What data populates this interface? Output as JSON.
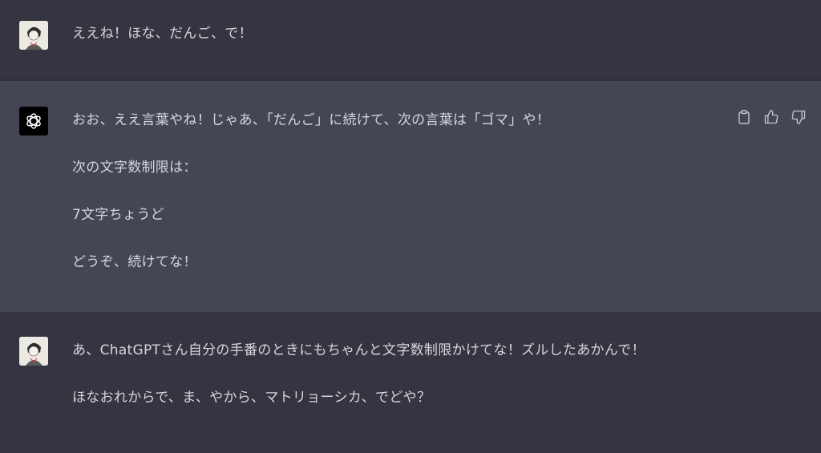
{
  "messages": [
    {
      "role": "user",
      "avatar_icon": "user-avatar-illustration",
      "paragraphs": [
        "ええね！ほな、だんご、で！"
      ]
    },
    {
      "role": "assistant",
      "avatar_icon": "openai-logo-icon",
      "paragraphs": [
        "おお、ええ言葉やね！じゃあ、「だんご」に続けて、次の言葉は「ゴマ」や！",
        "次の文字数制限は：",
        "7文字ちょうど",
        "どうぞ、続けてな！"
      ],
      "actions": [
        "copy-icon",
        "thumbs-up-icon",
        "thumbs-down-icon"
      ]
    },
    {
      "role": "user",
      "avatar_icon": "user-avatar-illustration",
      "paragraphs": [
        "あ、ChatGPTさん自分の手番のときにもちゃんと文字数制限かけてな！ズルしたあかんで！",
        "ほなおれからで、ま、やから、マトリョーシカ、でどや？"
      ]
    }
  ],
  "colors": {
    "page_bg": "#343541",
    "assistant_bg": "#444654",
    "text": "#d6d6dc"
  }
}
